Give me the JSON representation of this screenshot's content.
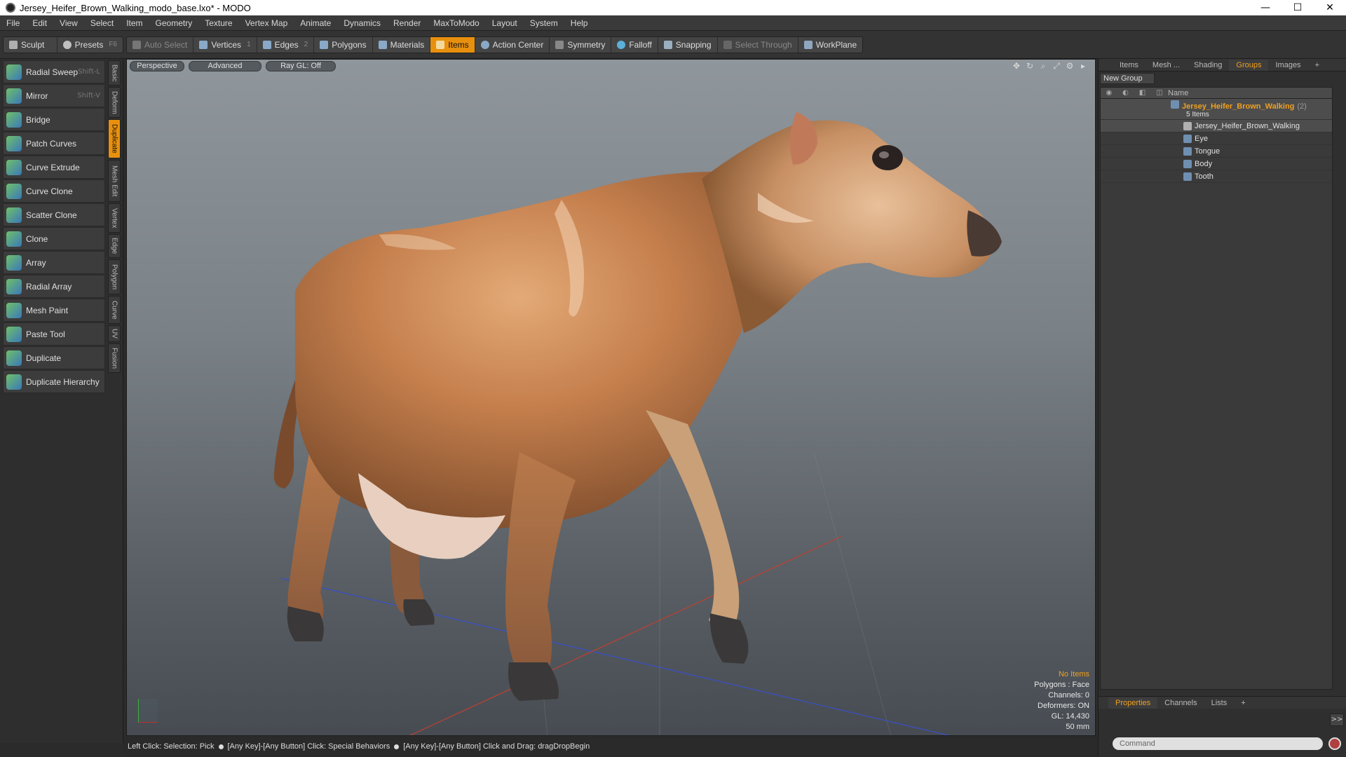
{
  "window": {
    "title": "Jersey_Heifer_Brown_Walking_modo_base.lxo* - MODO",
    "minimize": "—",
    "maximize": "☐",
    "close": "✕"
  },
  "menu": [
    "File",
    "Edit",
    "View",
    "Select",
    "Item",
    "Geometry",
    "Texture",
    "Vertex Map",
    "Animate",
    "Dynamics",
    "Render",
    "MaxToModo",
    "Layout",
    "System",
    "Help"
  ],
  "toolbar": {
    "sculpt": "Sculpt",
    "presets": "Presets",
    "presets_key": "F6",
    "auto_select": "Auto Select",
    "vertices": "Vertices",
    "vertices_num": "1",
    "edges": "Edges",
    "edges_num": "2",
    "polygons": "Polygons",
    "materials": "Materials",
    "items": "Items",
    "action_center": "Action Center",
    "symmetry": "Symmetry",
    "falloff": "Falloff",
    "snapping": "Snapping",
    "select_through": "Select Through",
    "workplane": "WorkPlane"
  },
  "tools": [
    {
      "label": "Radial Sweep",
      "shortcut": "Shift-L"
    },
    {
      "label": "Mirror",
      "shortcut": "Shift-V"
    },
    {
      "label": "Bridge",
      "shortcut": ""
    },
    {
      "label": "Patch Curves",
      "shortcut": ""
    },
    {
      "label": "Curve Extrude",
      "shortcut": ""
    },
    {
      "label": "Curve Clone",
      "shortcut": ""
    },
    {
      "label": "Scatter Clone",
      "shortcut": ""
    },
    {
      "label": "Clone",
      "shortcut": ""
    },
    {
      "label": "Array",
      "shortcut": ""
    },
    {
      "label": "Radial Array",
      "shortcut": ""
    },
    {
      "label": "Mesh Paint",
      "shortcut": ""
    },
    {
      "label": "Paste Tool",
      "shortcut": ""
    },
    {
      "label": "Duplicate",
      "shortcut": ""
    },
    {
      "label": "Duplicate Hierarchy",
      "shortcut": ""
    }
  ],
  "vtabs": [
    "Basic",
    "Deform",
    "Duplicate",
    "Mesh Edit",
    "Vertex",
    "Edge",
    "Polygon",
    "Curve",
    "UV",
    "Fusion"
  ],
  "viewport": {
    "perspective": "Perspective",
    "advanced": "Advanced",
    "raygl": "Ray GL: Off",
    "info": {
      "items": "No Items",
      "polygons": "Polygons : Face",
      "channels": "Channels: 0",
      "deformers": "Deformers: ON",
      "gl": "GL: 14,430",
      "unit": "50 mm"
    }
  },
  "right_panel": {
    "tabs": [
      "Items",
      "Mesh ...",
      "Shading",
      "Groups",
      "Images",
      "+"
    ],
    "new_group": "New Group",
    "name_col": "Name",
    "group": {
      "name": "Jersey_Heifer_Brown_Walking",
      "count": "(2)",
      "sub": "5 Items"
    },
    "children": [
      "Jersey_Heifer_Brown_Walking",
      "Eye",
      "Tongue",
      "Body",
      "Tooth"
    ],
    "prop_tabs": [
      "Properties",
      "Channels",
      "Lists",
      "+"
    ],
    "expand": ">>",
    "command_placeholder": "Command"
  },
  "status": {
    "s1": "Left Click: Selection: Pick",
    "s2": "[Any Key]-[Any Button] Click: Special Behaviors",
    "s3": "[Any Key]-[Any Button] Click and Drag: dragDropBegin"
  },
  "colors": {
    "accent": "#e8900e",
    "group_text": "#f0a020"
  }
}
